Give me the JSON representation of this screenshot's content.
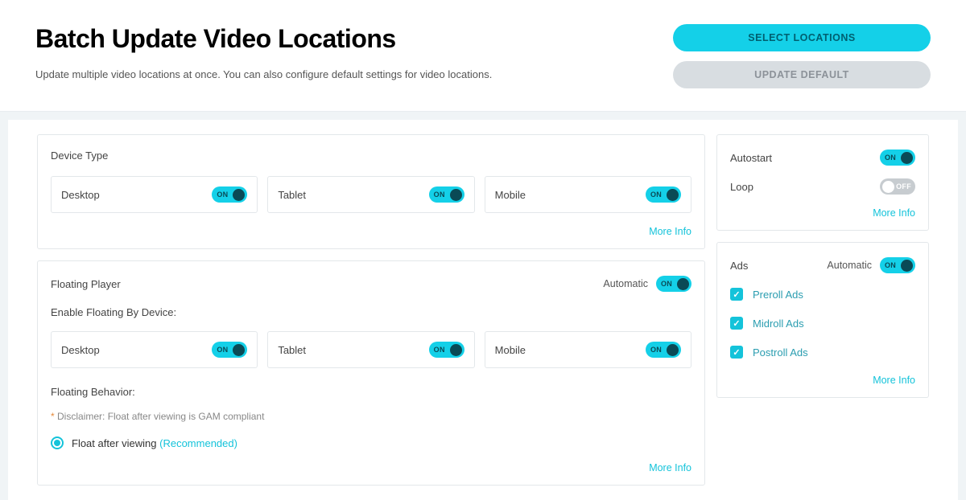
{
  "header": {
    "title": "Batch Update Video Locations",
    "subtitle": "Update multiple video locations at once. You can also configure default settings for video locations.",
    "select_btn": "SELECT LOCATIONS",
    "update_btn": "UPDATE DEFAULT"
  },
  "toggle_on": "ON",
  "toggle_off": "OFF",
  "more_info": "More Info",
  "automatic_label": "Automatic",
  "device_type": {
    "title": "Device Type",
    "desktop": "Desktop",
    "tablet": "Tablet",
    "mobile": "Mobile"
  },
  "playback": {
    "autostart": "Autostart",
    "loop": "Loop"
  },
  "floating": {
    "title": "Floating Player",
    "enable_by_device": "Enable Floating By Device:",
    "desktop": "Desktop",
    "tablet": "Tablet",
    "mobile": "Mobile",
    "behavior_title": "Floating Behavior:",
    "disclaimer": "Disclaimer: Float after viewing is GAM compliant",
    "option_after_viewing": "Float after viewing",
    "recommended": "(Recommended)"
  },
  "ads": {
    "title": "Ads",
    "preroll": "Preroll Ads",
    "midroll": "Midroll Ads",
    "postroll": "Postroll Ads"
  }
}
